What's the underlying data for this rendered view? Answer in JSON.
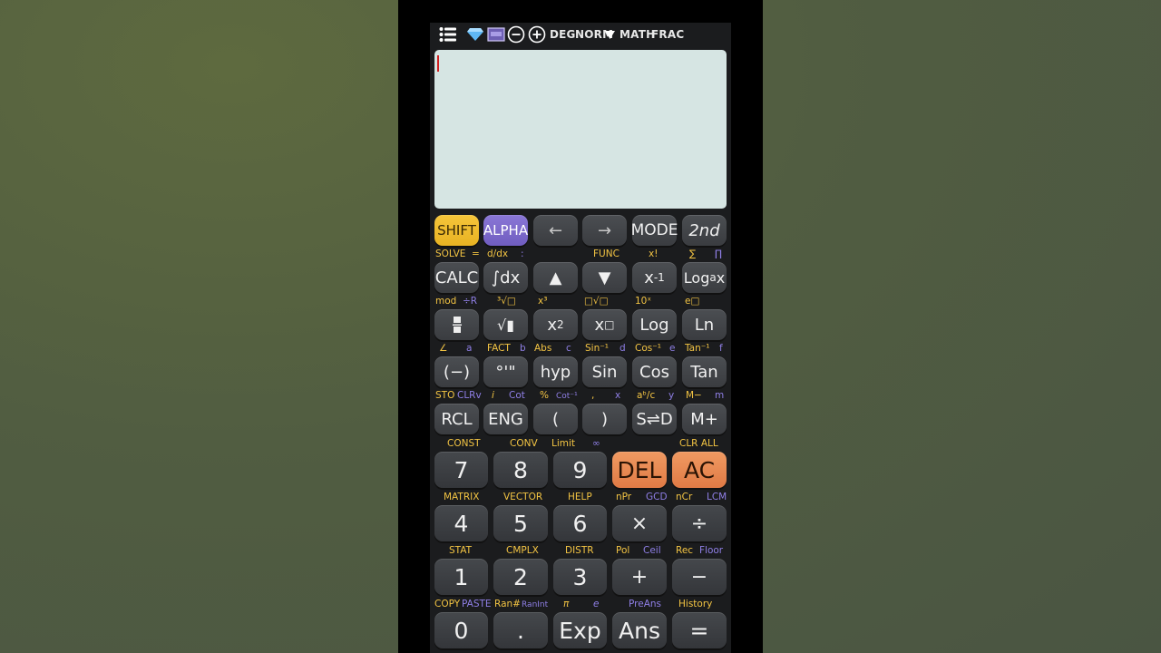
{
  "status_bar": {
    "deg": "DEG",
    "norm": "NORM",
    "math": "MATH",
    "frac": "FRAC",
    "icons": [
      "menu-icon",
      "diamond-icon",
      "display-toggle-icon",
      "zoom-out-icon",
      "zoom-in-icon",
      "dropdown-triangle-icon"
    ]
  },
  "keys": {
    "shift": "SHIFT",
    "alpha": "ALPHA",
    "left": "←",
    "right": "→",
    "mode": "MODE",
    "second": "2nd",
    "calc": "CALC",
    "integral": "∫dx",
    "up": "▲",
    "down": "▼",
    "inverse_base": "x",
    "inverse_exp": "-1",
    "loga_a": "Log",
    "loga_sub": "a",
    "loga_x": "x",
    "fraction_glyph": "▪",
    "sqrt": "√▮",
    "square_base": "x",
    "square_exp": "2",
    "power_base": "x",
    "power_exp": "□",
    "log": "Log",
    "ln": "Ln",
    "neg": "(−)",
    "dms": "°'\"",
    "hyp": "hyp",
    "sin": "Sin",
    "cos": "Cos",
    "tan": "Tan",
    "rcl": "RCL",
    "eng": "ENG",
    "lparen": "(",
    "rparen": ")",
    "sd": "S⇌D",
    "mplus": "M+",
    "n7": "7",
    "n8": "8",
    "n9": "9",
    "del": "DEL",
    "ac": "AC",
    "n4": "4",
    "n5": "5",
    "n6": "6",
    "times": "×",
    "divide": "÷",
    "n1": "1",
    "n2": "2",
    "n3": "3",
    "plus": "+",
    "minus": "−",
    "n0": "0",
    "dot": ".",
    "exp": "Exp",
    "ans": "Ans",
    "equals": "="
  },
  "labels": {
    "solve": "SOLVE",
    "eq": "=",
    "ddx": "d/dx",
    "colon": ":",
    "func": "FUNC",
    "fact_excl": "x!",
    "sigma": "∑",
    "pi_prod": "∏",
    "mod": "mod",
    "plus_r": "÷R",
    "cube_root": "³√□",
    "x_cubed": "x³",
    "nth_root": "□√□",
    "ten_x": "10ˣ",
    "e_x": "e□",
    "angle": "∠",
    "a": "a",
    "fact": "FACT",
    "b": "b",
    "abs": "Abs",
    "c": "c",
    "sin_inv": "Sin⁻¹",
    "d": "d",
    "cos_inv": "Cos⁻¹",
    "e": "e",
    "tan_inv": "Tan⁻¹",
    "f": "f",
    "sto": "STO",
    "clrv": "CLRv",
    "i": "i",
    "cot": "Cot",
    "percent": "%",
    "cot_inv": "Cot⁻¹",
    "comma": ",",
    "x": "x",
    "abc": "aᵇ/c",
    "y": "y",
    "m_minus": "M−",
    "m": "m",
    "const": "CONST",
    "conv": "CONV",
    "limit": "Limit",
    "infinity": "∞",
    "clr_all": "CLR ALL",
    "matrix": "MATRIX",
    "vector": "VECTOR",
    "help": "HELP",
    "npr": "nPr",
    "gcd": "GCD",
    "ncr": "nCr",
    "lcm": "LCM",
    "stat": "STAT",
    "cmplx": "CMPLX",
    "distr": "DISTR",
    "pol": "Pol",
    "ceil": "Ceil",
    "rec": "Rec",
    "floor": "Floor",
    "copy": "COPY",
    "paste": "PASTE",
    "ran": "Ran#",
    "ranint": "RanInt",
    "pi": "π",
    "e_const": "e",
    "preans": "PreAns",
    "history": "History"
  },
  "colors": {
    "shift": "#f3c443",
    "alpha": "#8f7fe6",
    "del_ac": "#e88a55",
    "display": "#d6e5e3",
    "cursor": "#d02020"
  }
}
